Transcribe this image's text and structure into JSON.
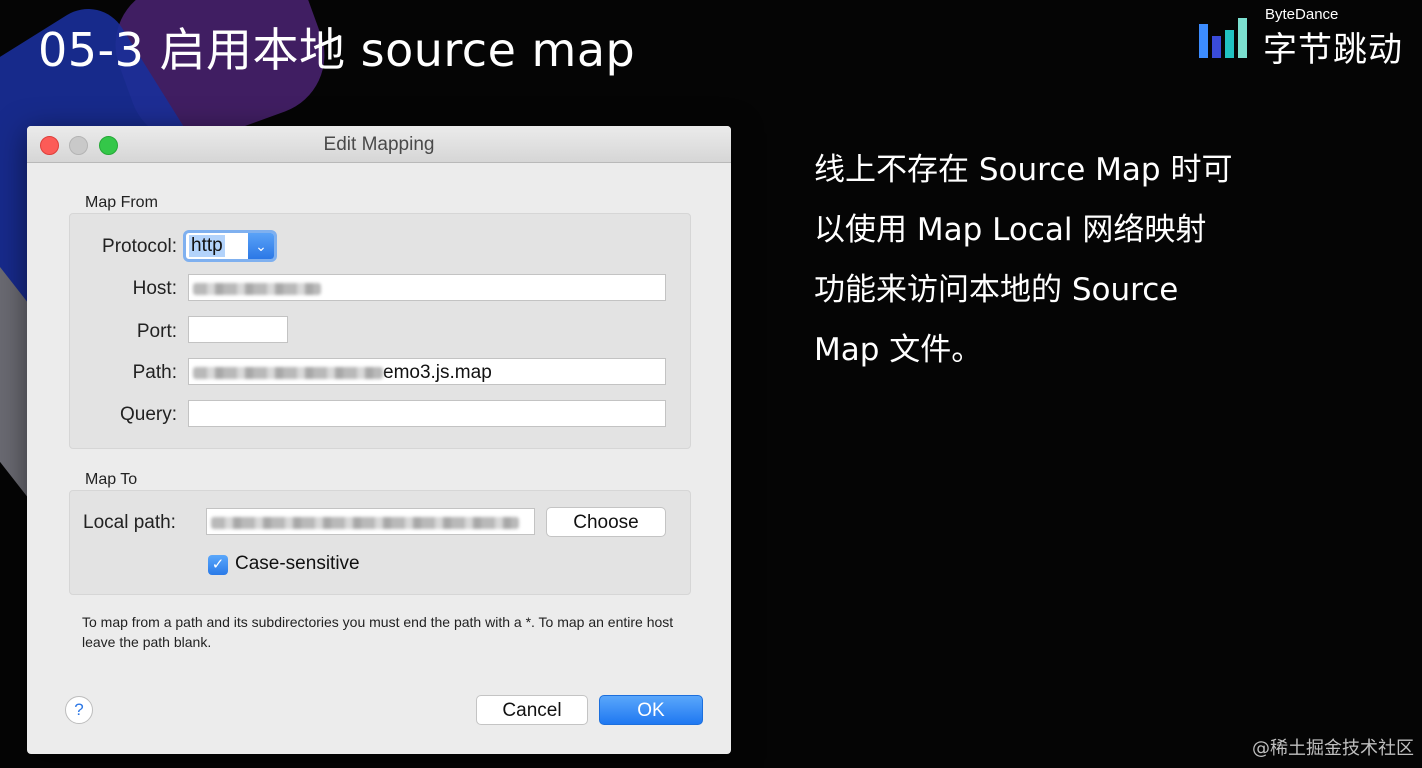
{
  "slide": {
    "title": "05-3 启用本地 source map",
    "description_lines": [
      "线上不存在 Source Map 时可",
      "以使用 Map Local 网络映射",
      "功能来访问本地的 Source",
      "Map 文件。"
    ],
    "watermark": "@稀土掘金技术社区"
  },
  "logo": {
    "english": "ByteDance",
    "chinese": "字节跳动"
  },
  "dialog": {
    "title": "Edit Mapping",
    "map_from": {
      "section_label": "Map From",
      "protocol_label": "Protocol:",
      "protocol_value": "http",
      "host_label": "Host:",
      "port_label": "Port:",
      "path_label": "Path:",
      "path_visible_suffix": "emo3.js.map",
      "query_label": "Query:"
    },
    "map_to": {
      "section_label": "Map To",
      "local_path_label": "Local path:",
      "choose_label": "Choose",
      "case_sensitive_label": "Case-sensitive",
      "case_sensitive_checked": true
    },
    "help_text": "To map from a path and its subdirectories you must end the path with a *. To map an entire host leave the path blank.",
    "help_button": "?",
    "cancel_label": "Cancel",
    "ok_label": "OK"
  },
  "colors": {
    "accent_blue": "#2b78e6",
    "close": "#fc5b57",
    "minimize": "#c9c9c9",
    "maximize": "#34c749"
  }
}
